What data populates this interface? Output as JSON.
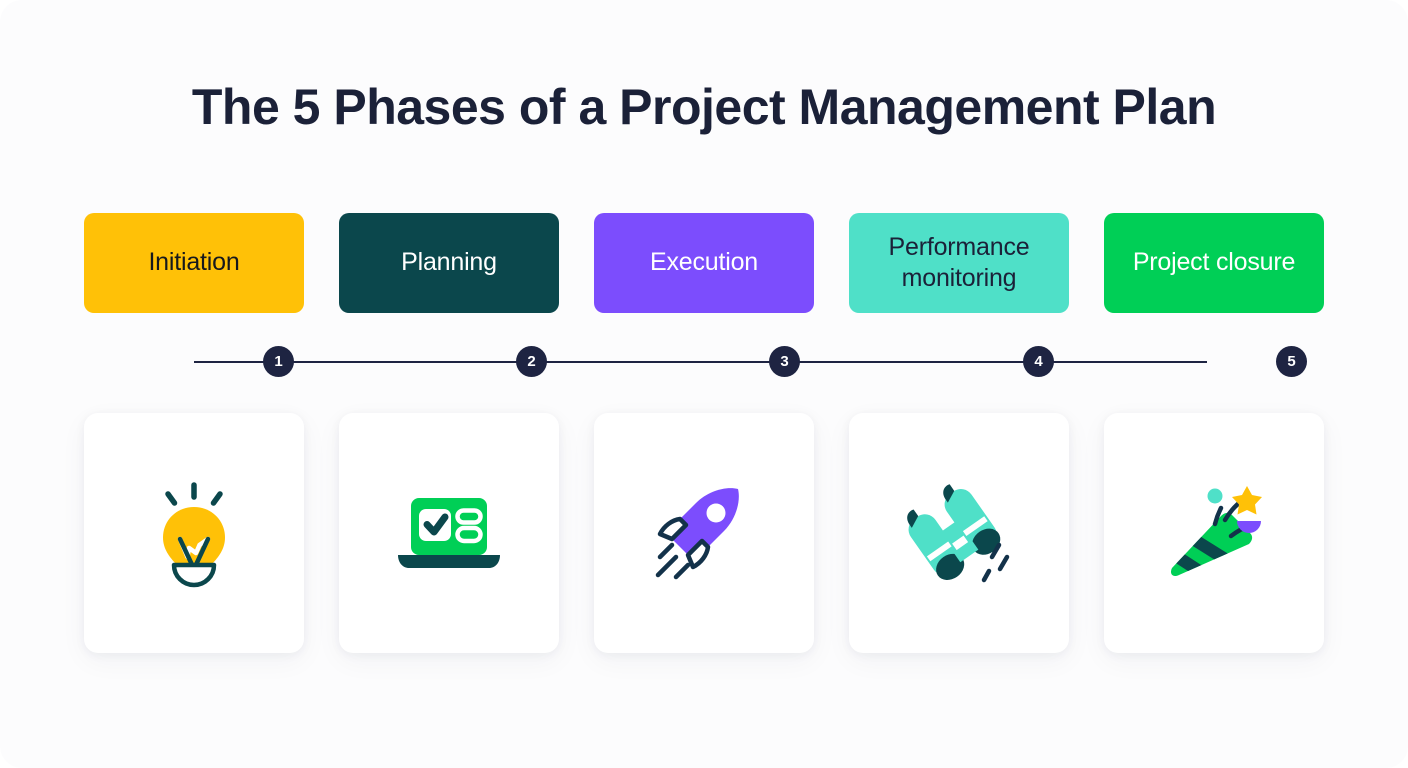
{
  "header": {
    "title": "The 5 Phases of a Project Management Plan"
  },
  "colors": {
    "background": "#fcfcfd",
    "navy": "#1e2442",
    "amber": "#ffc107",
    "dark_teal": "#0b474c",
    "purple": "#7c4dfd",
    "mint": "#4fe0c8",
    "green": "#00cf56",
    "white": "#ffffff"
  },
  "phases": [
    {
      "step": "1",
      "label": "Initiation",
      "card_color": "#ffc107",
      "text_color": "#16181d",
      "icon_name": "lightbulb-icon"
    },
    {
      "step": "2",
      "label": "Planning",
      "card_color": "#0b474c",
      "text_color": "#ffffff",
      "icon_name": "laptop-checklist-icon"
    },
    {
      "step": "3",
      "label": "Execution",
      "card_color": "#7c4dfd",
      "text_color": "#ffffff",
      "icon_name": "rocket-icon"
    },
    {
      "step": "4",
      "label": "Performance monitoring",
      "card_color": "#4fe0c8",
      "text_color": "#1b2138",
      "icon_name": "binoculars-icon"
    },
    {
      "step": "5",
      "label": "Project closure",
      "card_color": "#00cf56",
      "text_color": "#ffffff",
      "icon_name": "party-popper-icon"
    }
  ]
}
